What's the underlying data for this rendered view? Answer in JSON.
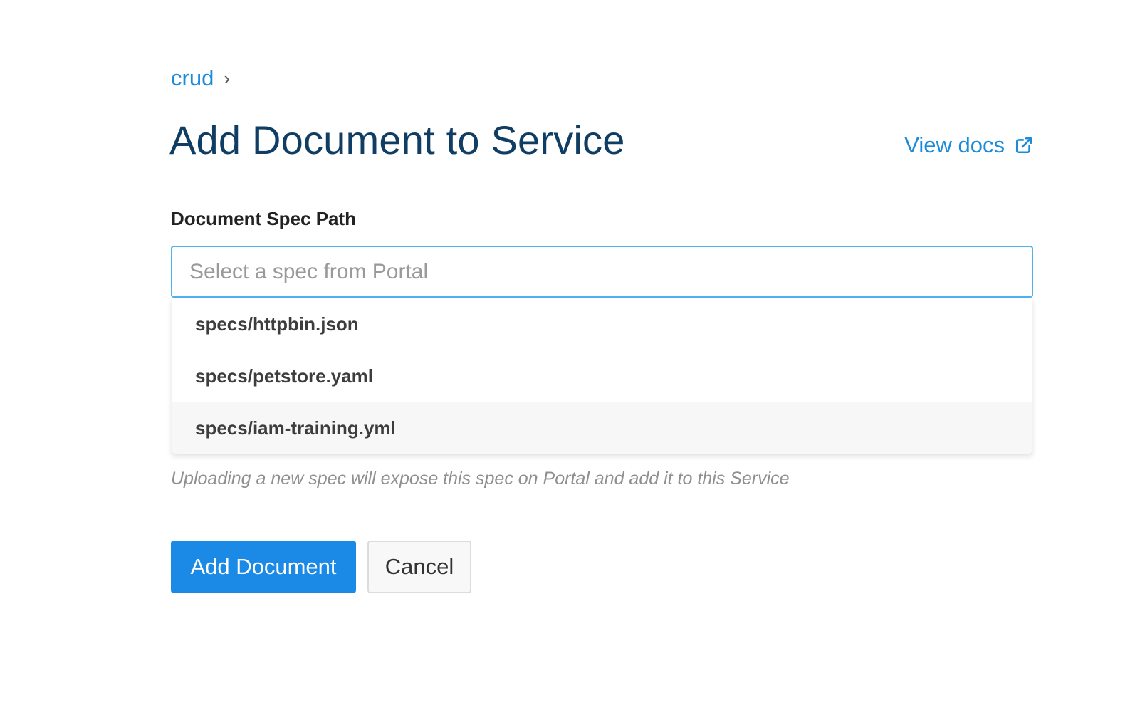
{
  "breadcrumb": {
    "link": "crud",
    "separator": "›"
  },
  "page": {
    "title": "Add Document to Service"
  },
  "docs_link": {
    "label": "View docs",
    "icon": "external-link-icon"
  },
  "form": {
    "spec_path_label": "Document Spec Path",
    "spec_input": {
      "value": "",
      "placeholder": "Select a spec from Portal"
    },
    "dropdown_options": [
      {
        "label": "specs/httpbin.json",
        "highlighted": false
      },
      {
        "label": "specs/petstore.yaml",
        "highlighted": false
      },
      {
        "label": "specs/iam-training.yml",
        "highlighted": true
      }
    ],
    "help_text": "Uploading a new spec will expose this spec on Portal and add it to this Service"
  },
  "actions": {
    "submit_label": "Add Document",
    "cancel_label": "Cancel"
  },
  "colors": {
    "accent": "#1a8ad9",
    "primary_button": "#1a8ae6",
    "title": "#0f3d63",
    "input_focus_border": "#4fb2ee"
  }
}
